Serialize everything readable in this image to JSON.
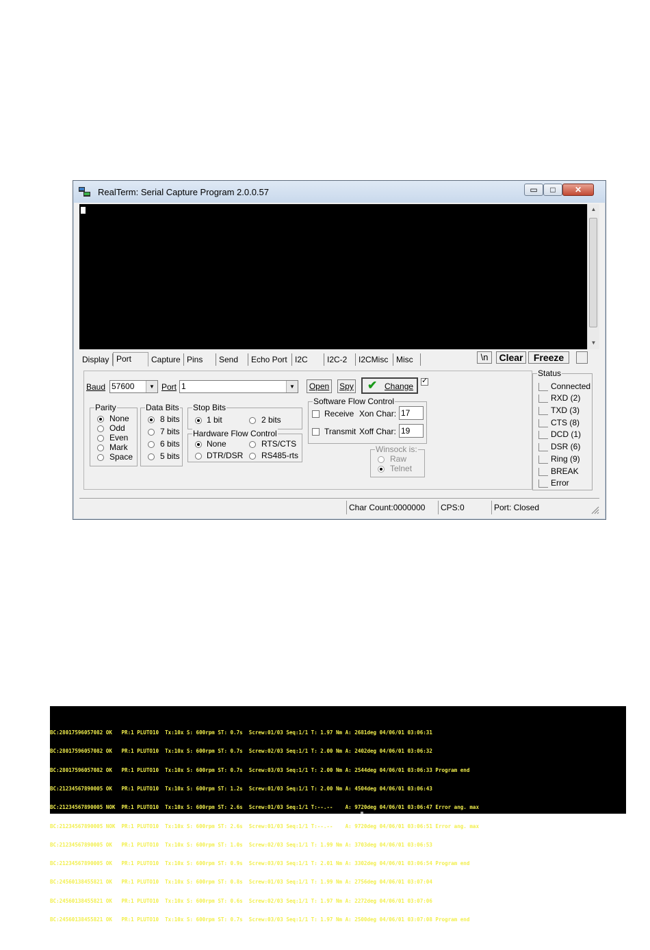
{
  "window": {
    "title": "RealTerm: Serial Capture Program 2.0.0.57",
    "caption_buttons": {
      "minimize": "▭",
      "maximize": "□",
      "close": "✕"
    }
  },
  "tabs": [
    "Display",
    "Port",
    "Capture",
    "Pins",
    "Send",
    "Echo Port",
    "I2C",
    "I2C-2",
    "I2CMisc",
    "Misc"
  ],
  "active_tab": "Port",
  "toolbar": {
    "newline": "\\n",
    "clear": "Clear",
    "freeze": "Freeze"
  },
  "port": {
    "baud_label": "Baud",
    "baud_value": "57600",
    "port_label": "Port",
    "port_value": "1",
    "open": "Open",
    "spy": "Spy",
    "change": "Change",
    "parity": {
      "label": "Parity",
      "options": [
        "None",
        "Odd",
        "Even",
        "Mark",
        "Space"
      ]
    },
    "data_bits": {
      "label": "Data Bits",
      "options": [
        "8 bits",
        "7 bits",
        "6 bits",
        "5 bits"
      ]
    },
    "stop_bits": {
      "label": "Stop Bits",
      "options": [
        "1 bit",
        "2 bits"
      ]
    },
    "hw_flow": {
      "label": "Hardware Flow Control",
      "options": [
        "None",
        "RTS/CTS",
        "DTR/DSR",
        "RS485-rts"
      ]
    },
    "sw_flow": {
      "label": "Software Flow Control",
      "receive": "Receive",
      "transmit": "Transmit",
      "xon_label": "Xon Char:",
      "xon_value": "17",
      "xoff_label": "Xoff Char:",
      "xoff_value": "19"
    },
    "winsock": {
      "label": "Winsock is:",
      "options": [
        "Raw",
        "Telnet"
      ]
    }
  },
  "status": {
    "label": "Status",
    "items": [
      "Connected",
      "RXD (2)",
      "TXD (3)",
      "CTS (8)",
      "DCD (1)",
      "DSR (6)",
      "Ring (9)",
      "BREAK",
      "Error"
    ]
  },
  "statusbar": {
    "char_count": "Char Count:0000000",
    "cps": "CPS:0",
    "port_state": "Port: Closed"
  },
  "log": [
    "BC:28017596057082 OK   PR:1 PLUTO10  Tx:10x S: 600rpm ST: 0.7s  Screw:01/03 Seq:1/1 T: 1.97 Nm A: 2681deg 04/06/01 03:06:31",
    "BC:28017596057082 OK   PR:1 PLUTO10  Tx:10x S: 600rpm ST: 0.7s  Screw:02/03 Seq:1/1 T: 2.00 Nm A: 2402deg 04/06/01 03:06:32",
    "BC:28017596057082 OK   PR:1 PLUTO10  Tx:10x S: 600rpm ST: 0.7s  Screw:03/03 Seq:1/1 T: 2.00 Nm A: 2544deg 04/06/01 03:06:33 Program end",
    "BC:21234567890005 OK   PR:1 PLUTO10  Tx:10x S: 600rpm ST: 1.2s  Screw:01/03 Seq:1/1 T: 2.00 Nm A: 4504deg 04/06/01 03:06:43",
    "BC:21234567890005 NOK  PR:1 PLUTO10  Tx:10x S: 600rpm ST: 2.6s  Screw:01/03 Seq:1/1 T:--.--    A: 9720deg 04/06/01 03:06:47 Error ang. max",
    "BC:21234567890005 NOK  PR:1 PLUTO10  Tx:10x S: 600rpm ST: 2.6s  Screw:01/03 Seq:1/1 T:--.--    A: 9720deg 04/06/01 03:06:51 Error ang. max",
    "BC:21234567890005 OK   PR:1 PLUTO10  Tx:10x S: 600rpm ST: 1.0s  Screw:02/03 Seq:1/1 T: 1.99 Nm A: 3703deg 04/06/01 03:06:53",
    "BC:21234567890005 OK   PR:1 PLUTO10  Tx:10x S: 600rpm ST: 0.9s  Screw:03/03 Seq:1/1 T: 2.01 Nm A: 3302deg 04/06/01 03:06:54 Program end",
    "BC:24560138455821 OK   PR:1 PLUTO10  Tx:10x S: 600rpm ST: 0.8s  Screw:01/03 Seq:1/1 T: 1.99 Nm A: 2756deg 04/06/01 03:07:04",
    "BC:24560138455821 OK   PR:1 PLUTO10  Tx:10x S: 600rpm ST: 0.6s  Screw:02/03 Seq:1/1 T: 1.97 Nm A: 2272deg 04/06/01 03:07:06",
    "BC:24560138455821 OK   PR:1 PLUTO10  Tx:10x S: 600rpm ST: 0.7s  Screw:03/03 Seq:1/1 T: 1.97 Nm A: 2500deg 04/06/01 03:07:08 Program end"
  ]
}
